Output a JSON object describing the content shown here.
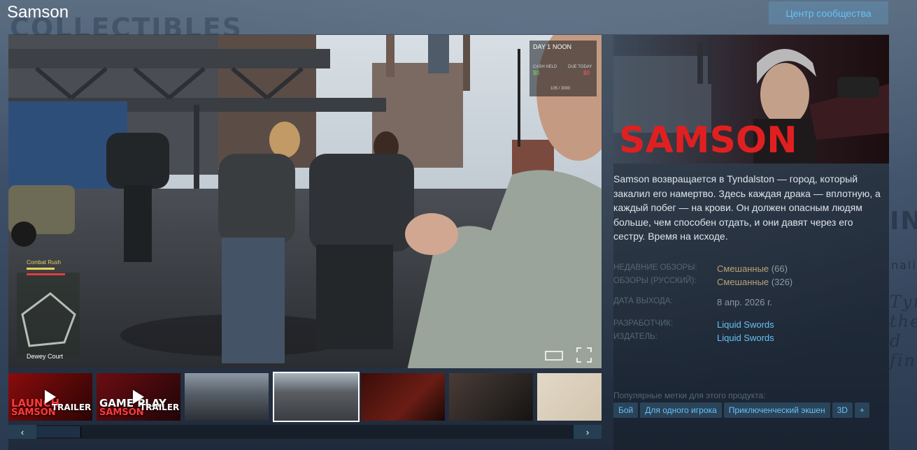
{
  "header": {
    "title": "Samson",
    "community_button": "Центр сообщества"
  },
  "background": {
    "word_top": "COLLECTIBLES",
    "word_right": "ING",
    "word_right2": "naling",
    "script_text": "Tyn the d fin"
  },
  "player": {
    "hud": {
      "day": "DAY 1",
      "time": "NOON",
      "cash_label": "CASH HELD",
      "cash_value": "$0",
      "due_label": "DUE TODAY",
      "due_value": "$0",
      "progress_text": "105 / 3000",
      "combat_label": "Combat Rush",
      "location": "Dewey Court"
    }
  },
  "thumbnails": [
    {
      "kind": "video",
      "caption_top": "LAUNCH",
      "caption_sub": "TRAILER",
      "logo": "SAMSON"
    },
    {
      "kind": "video",
      "caption_top": "GAME PLAY",
      "caption_sub": "TRAILER",
      "logo": "SAMSON"
    },
    {
      "kind": "image"
    },
    {
      "kind": "image",
      "active": true
    },
    {
      "kind": "image"
    },
    {
      "kind": "image"
    },
    {
      "kind": "image"
    }
  ],
  "slider": {
    "prev": "‹",
    "next": "›"
  },
  "capsule": {
    "logo_text": "SAMSON"
  },
  "description": "Samson возвращается в Tyndalston — город, который закалил его намертво. Здесь каждая драка — вплотную, а каждый побег — на крови. Он должен опасным людям больше, чем способен отдать, и они давят через его сестру. Время на исходе.",
  "reviews": {
    "recent_label": "НЕДАВНИЕ ОБЗОРЫ:",
    "recent_summary": "Смешанные",
    "recent_count": "(66)",
    "russian_label": "ОБЗОРЫ (РУССКИЙ):",
    "russian_summary": "Смешанные",
    "russian_count": "(326)"
  },
  "release": {
    "label": "ДАТА ВЫХОДА:",
    "date": "8 апр. 2026 г."
  },
  "developer": {
    "label": "РАЗРАБОТЧИК:",
    "name": "Liquid Swords"
  },
  "publisher": {
    "label": "ИЗДАТЕЛЬ:",
    "name": "Liquid Swords"
  },
  "tags": {
    "label": "Популярные метки для этого продукта:",
    "items": [
      "Бой",
      "Для одного игрока",
      "Приключенческий экшен",
      "3D",
      "+"
    ]
  },
  "colors": {
    "accent": "#67c1f5",
    "mixed": "#b9a074",
    "title": "#ffffff"
  }
}
